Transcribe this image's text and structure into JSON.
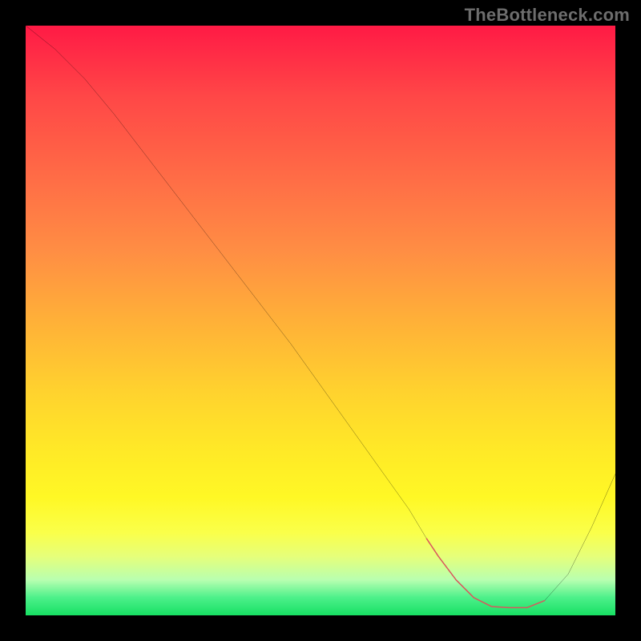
{
  "watermark": "TheBottleneck.com",
  "chart_data": {
    "type": "line",
    "title": "",
    "xlabel": "",
    "ylabel": "",
    "xlim": [
      0,
      100
    ],
    "ylim": [
      0,
      100
    ],
    "series": [
      {
        "name": "curve",
        "x": [
          0,
          5,
          10,
          15,
          20,
          25,
          30,
          35,
          40,
          45,
          50,
          55,
          60,
          65,
          68,
          70,
          73,
          76,
          79,
          82,
          85,
          88,
          92,
          96,
          100
        ],
        "y": [
          100,
          96,
          91,
          85,
          78.5,
          72,
          65.5,
          59,
          52.5,
          46,
          39,
          32,
          25,
          18,
          13,
          10,
          6,
          3,
          1.5,
          1.3,
          1.3,
          2.5,
          7,
          15,
          24
        ]
      },
      {
        "name": "highlight",
        "x": [
          68,
          70,
          73,
          76,
          79,
          82,
          85,
          88
        ],
        "y": [
          13,
          10,
          6,
          3,
          1.5,
          1.3,
          1.3,
          2.5
        ]
      }
    ],
    "gradient_stops": [
      {
        "pos": 0,
        "color": "#ff1a45"
      },
      {
        "pos": 12,
        "color": "#ff4747"
      },
      {
        "pos": 25,
        "color": "#ff6a46"
      },
      {
        "pos": 38,
        "color": "#ff8d44"
      },
      {
        "pos": 50,
        "color": "#ffb038"
      },
      {
        "pos": 62,
        "color": "#ffd22e"
      },
      {
        "pos": 72,
        "color": "#ffe927"
      },
      {
        "pos": 80,
        "color": "#fff825"
      },
      {
        "pos": 86,
        "color": "#faff4a"
      },
      {
        "pos": 90,
        "color": "#e6ff7a"
      },
      {
        "pos": 94,
        "color": "#b8ffb0"
      },
      {
        "pos": 97,
        "color": "#4cf08a"
      },
      {
        "pos": 100,
        "color": "#17e063"
      }
    ],
    "colors": {
      "curve": "#000000",
      "highlight": "#d9575d",
      "background": "#000000"
    }
  }
}
